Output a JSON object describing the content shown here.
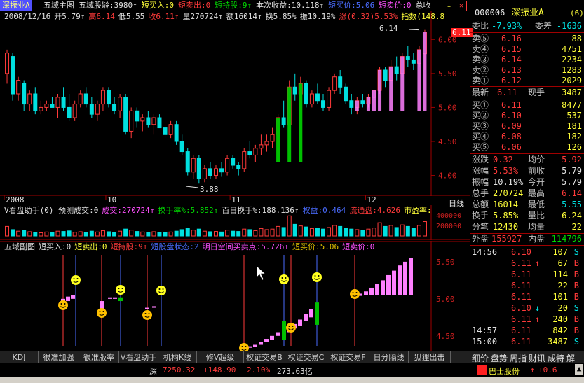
{
  "main_header": {
    "stock_name": "深振业A",
    "items": [
      {
        "text": "五域主图",
        "color": "#e0e0e0"
      },
      {
        "text": "五域股龄:3980↑",
        "color": "#e0e0e0"
      },
      {
        "text": "短买入:0",
        "color": "#ffff3a"
      },
      {
        "text": "短卖出:0",
        "color": "#ff3a3a"
      },
      {
        "text": "短持股:9↑",
        "color": "#00d800"
      },
      {
        "text": "本次收益:10.118↑",
        "color": "#e0e0e0"
      },
      {
        "text": "短买价:5.06",
        "color": "#4a6cff"
      },
      {
        "text": "短卖价:0",
        "color": "#ff50ff"
      },
      {
        "text": "总收",
        "color": "#e0e0e0"
      }
    ],
    "info2": [
      {
        "text": "2008/12/16",
        "color": "#e0e0e0"
      },
      {
        "text": "开5.79↑",
        "color": "#e0e0e0"
      },
      {
        "text": "高6.14",
        "color": "#ff3a3a"
      },
      {
        "text": "低5.55",
        "color": "#e0e0e0"
      },
      {
        "text": "收6.11↑",
        "color": "#ff3a3a"
      },
      {
        "text": "量270724↑",
        "color": "#e0e0e0"
      },
      {
        "text": "额16014↑",
        "color": "#e0e0e0"
      },
      {
        "text": "换5.85%",
        "color": "#e0e0e0"
      },
      {
        "text": "振10.19%",
        "color": "#e0e0e0"
      },
      {
        "text": "涨(0.32)5.53%",
        "color": "#ff3a3a"
      },
      {
        "text": "指数(148.8",
        "color": "#ffff3a"
      }
    ],
    "high_marker": "6.14",
    "low_marker": "3.88",
    "price_tag": "6.11",
    "y_labels": [
      "6.00",
      "5.50",
      "5.00",
      "4.50",
      "4.00"
    ],
    "x_labels": [
      "2008",
      "10",
      "11",
      "12"
    ],
    "daily_label": "日线"
  },
  "vol_header": {
    "items": [
      {
        "text": "V看盘助手(0) 预测成交:0",
        "color": "#e0e0e0"
      },
      {
        "text": "成交:270724↑",
        "color": "#ff50ff"
      },
      {
        "text": "换手率%:5.852↑",
        "color": "#00d800"
      },
      {
        "text": "百日换手%:188.136↑",
        "color": "#e0e0e0"
      },
      {
        "text": "权益:0.464",
        "color": "#4a6cff"
      },
      {
        "text": "流通盘:4.626",
        "color": "#ff3a3a"
      },
      {
        "text": "市盈率:",
        "color": "#ffff3a"
      }
    ],
    "y_labels": [
      "400000",
      "200000"
    ]
  },
  "sub_header": {
    "items": [
      {
        "text": "五域副图",
        "color": "#e0e0e0"
      },
      {
        "text": "短买入:0",
        "color": "#e0e0e0"
      },
      {
        "text": "短卖出:0",
        "color": "#ffff3a"
      },
      {
        "text": "短持股:9↑",
        "color": "#ff3a3a"
      },
      {
        "text": "短股盘状态:2",
        "color": "#4a6cff"
      },
      {
        "text": "明日空间买卖点:5.726↑",
        "color": "#ff50ff"
      },
      {
        "text": "短买价:5.06",
        "color": "#e0c000"
      },
      {
        "text": "短卖价:0",
        "color": "#ff50ff"
      }
    ],
    "y_labels": [
      "5.50",
      "5.00",
      "4.50"
    ]
  },
  "tabs": [
    "KDJ",
    "很准加强",
    "很准版率",
    "V看盘助手",
    "机构K线",
    "修V超级MACD",
    "权证交易B",
    "权证交易C",
    "权证交易F",
    "日分隔线",
    "狐狸出击"
  ],
  "right_panel": {
    "code": "000006",
    "name": "深振业A",
    "weibi_label": "委比",
    "weibi_value": "-7.93%",
    "weicha_label": "委差",
    "weicha_value": "-1636",
    "sells": [
      {
        "label": "卖⑤",
        "price": "6.16",
        "vol": "88"
      },
      {
        "label": "卖④",
        "price": "6.15",
        "vol": "4751"
      },
      {
        "label": "卖③",
        "price": "6.14",
        "vol": "2234"
      },
      {
        "label": "卖②",
        "price": "6.13",
        "vol": "1283"
      },
      {
        "label": "卖①",
        "price": "6.12",
        "vol": "2029"
      }
    ],
    "latest_label": "最新",
    "latest_price": "6.11",
    "xianshou_label": "现手",
    "xianshou_value": "3487",
    "buys": [
      {
        "label": "买①",
        "price": "6.11",
        "vol": "8477"
      },
      {
        "label": "买②",
        "price": "6.10",
        "vol": "537"
      },
      {
        "label": "买③",
        "price": "6.09",
        "vol": "181"
      },
      {
        "label": "买④",
        "price": "6.08",
        "vol": "182"
      },
      {
        "label": "买⑤",
        "price": "6.06",
        "vol": "126"
      }
    ],
    "stats": [
      {
        "l1": "涨跌",
        "v1": "0.32",
        "c1": "#ff3a3a",
        "l2": "均价",
        "v2": "5.92",
        "c2": "#ff3a3a"
      },
      {
        "l1": "涨幅",
        "v1": "5.53%",
        "c1": "#ff3a3a",
        "l2": "前收",
        "v2": "5.79",
        "c2": "#e0e0e0"
      },
      {
        "l1": "振幅",
        "v1": "10.19%",
        "c1": "#e0e0e0",
        "l2": "今开",
        "v2": "5.79",
        "c2": "#e0e0e0"
      },
      {
        "l1": "总手",
        "v1": "270724",
        "c1": "#ffff3a",
        "l2": "最高",
        "v2": "6.14",
        "c2": "#ff3a3a"
      },
      {
        "l1": "总额",
        "v1": "16014",
        "c1": "#ffff3a",
        "l2": "最低",
        "v2": "5.55",
        "c2": "#00e0e0"
      },
      {
        "l1": "换手",
        "v1": "5.85%",
        "c1": "#ffff3a",
        "l2": "量比",
        "v2": "6.24",
        "c2": "#ffff3a"
      },
      {
        "l1": "分笔",
        "v1": "12430",
        "c1": "#ffff3a",
        "l2": "均量",
        "v2": "22",
        "c2": "#ffff3a"
      }
    ],
    "waipan_label": "外盘",
    "waipan_value": "155927",
    "neipan_label": "内盘",
    "neipan_value": "114796",
    "ticks": [
      {
        "time": "14:56",
        "price": "6.10",
        "arrow": "",
        "vol": "107",
        "side": "S"
      },
      {
        "time": "",
        "price": "6.11",
        "arrow": "↑",
        "vol": "67",
        "side": "B"
      },
      {
        "time": "",
        "price": "6.11",
        "arrow": "",
        "vol": "114",
        "side": "B"
      },
      {
        "time": "",
        "price": "6.11",
        "arrow": "",
        "vol": "22",
        "side": "B"
      },
      {
        "time": "",
        "price": "6.11",
        "arrow": "",
        "vol": "101",
        "side": "B"
      },
      {
        "time": "",
        "price": "6.10",
        "arrow": "↓",
        "vol": "20",
        "side": "S"
      },
      {
        "time": "",
        "price": "6.11",
        "arrow": "↑",
        "vol": "240",
        "side": "B"
      },
      {
        "time": "14:57",
        "price": "6.11",
        "arrow": "",
        "vol": "842",
        "side": "B"
      },
      {
        "time": "15:00",
        "price": "6.11",
        "arrow": "",
        "vol": "3487",
        "side": "S"
      }
    ],
    "bottom_tabs": [
      "细价",
      "盘势",
      "周指",
      "财讯",
      "成特",
      "解"
    ]
  },
  "ticker": {
    "market": "深",
    "index": "7250.32",
    "change": "+148.90",
    "pct": "2.10%",
    "amount": "273.63亿",
    "broker": "巴士股份",
    "broker_arrow": "↑",
    "broker_change": "+0.6"
  },
  "colors": {
    "up": "#ff3a3a",
    "down": "#00e0e0",
    "pink": "#ff80ff",
    "green": "#00c000",
    "frame": "#a00000"
  },
  "chart_data": [
    {
      "type": "candlestick",
      "title": "五域主图",
      "ylim": [
        3.8,
        6.25
      ],
      "y_ticks": [
        4.0,
        4.5,
        5.0,
        5.5,
        6.0
      ],
      "x_labels": [
        "2008",
        "10",
        "11",
        "12"
      ],
      "ohlc": [
        [
          5.5,
          5.85,
          5.35,
          5.8
        ],
        [
          5.75,
          5.8,
          5.1,
          5.2
        ],
        [
          5.2,
          5.45,
          5.1,
          5.4
        ],
        [
          5.35,
          5.4,
          4.95,
          5.05
        ],
        [
          5.05,
          5.25,
          4.95,
          5.2
        ],
        [
          5.2,
          5.3,
          4.9,
          4.95
        ],
        [
          4.95,
          5.1,
          4.9,
          5.0
        ],
        [
          5.0,
          5.1,
          4.95,
          5.05
        ],
        [
          5.05,
          5.15,
          5.0,
          5.0
        ],
        [
          5.0,
          5.2,
          4.85,
          5.15
        ],
        [
          5.15,
          5.3,
          4.95,
          5.0
        ],
        [
          5.0,
          5.2,
          4.8,
          4.85
        ],
        [
          4.85,
          5.1,
          4.8,
          5.05
        ],
        [
          5.05,
          5.25,
          5.0,
          5.2
        ],
        [
          5.2,
          5.3,
          5.0,
          5.05
        ],
        [
          5.05,
          5.15,
          4.85,
          4.9
        ],
        [
          4.9,
          5.1,
          4.8,
          5.05
        ],
        [
          5.05,
          5.3,
          4.95,
          5.25
        ],
        [
          5.25,
          5.3,
          5.0,
          5.05
        ],
        [
          5.05,
          5.15,
          4.9,
          4.95
        ],
        [
          4.95,
          5.2,
          4.85,
          5.15
        ],
        [
          5.15,
          5.2,
          4.6,
          4.65
        ],
        [
          4.65,
          5.0,
          4.55,
          4.95
        ],
        [
          4.95,
          5.0,
          4.7,
          4.8
        ],
        [
          4.8,
          4.9,
          4.65,
          4.85
        ],
        [
          4.85,
          4.95,
          4.7,
          4.75
        ],
        [
          4.75,
          4.9,
          4.6,
          4.85
        ],
        [
          4.85,
          4.9,
          4.7,
          4.7
        ],
        [
          4.7,
          4.75,
          4.55,
          4.6
        ],
        [
          4.6,
          4.8,
          4.55,
          4.75
        ],
        [
          4.75,
          4.8,
          4.45,
          4.5
        ],
        [
          4.5,
          4.6,
          4.3,
          4.35
        ],
        [
          4.35,
          4.4,
          4.0,
          4.05
        ],
        [
          4.05,
          4.3,
          3.95,
          4.25
        ],
        [
          4.25,
          4.3,
          3.88,
          3.95
        ],
        [
          3.95,
          4.15,
          3.9,
          4.1
        ],
        [
          4.1,
          4.2,
          3.95,
          4.0
        ],
        [
          4.0,
          4.15,
          3.95,
          4.1
        ],
        [
          4.1,
          4.2,
          3.98,
          4.05
        ],
        [
          4.05,
          4.3,
          4.0,
          4.25
        ],
        [
          4.25,
          4.3,
          4.1,
          4.15
        ],
        [
          4.15,
          4.2,
          4.0,
          4.1
        ],
        [
          4.1,
          4.4,
          4.05,
          4.35
        ],
        [
          4.35,
          4.5,
          4.25,
          4.3
        ],
        [
          4.3,
          4.45,
          4.2,
          4.4
        ],
        [
          4.4,
          4.6,
          4.3,
          4.45
        ],
        [
          4.45,
          4.6,
          4.35,
          4.5
        ],
        [
          4.5,
          4.7,
          4.4,
          4.6
        ],
        [
          4.6,
          4.9,
          4.5,
          4.85
        ],
        [
          4.85,
          5.1,
          4.7,
          4.75
        ],
        [
          4.75,
          5.4,
          4.7,
          5.3
        ],
        [
          5.3,
          5.5,
          5.1,
          5.2
        ],
        [
          5.2,
          5.45,
          5.05,
          5.35
        ],
        [
          5.35,
          5.4,
          5.0,
          5.05
        ],
        [
          5.05,
          5.25,
          5.0,
          5.2
        ],
        [
          5.2,
          5.35,
          5.05,
          5.1
        ],
        [
          5.1,
          5.2,
          4.95,
          5.0
        ],
        [
          5.0,
          5.3,
          4.95,
          5.25
        ],
        [
          5.25,
          5.5,
          5.2,
          5.45
        ],
        [
          5.45,
          5.55,
          5.2,
          5.3
        ],
        [
          5.3,
          5.35,
          5.05,
          5.1
        ],
        [
          5.1,
          5.2,
          4.9,
          5.0
        ],
        [
          5.0,
          5.15,
          4.9,
          5.1
        ],
        [
          5.1,
          5.2,
          5.0,
          5.05
        ],
        [
          5.05,
          5.2,
          5.0,
          5.15
        ],
        [
          5.15,
          5.3,
          5.1,
          5.25
        ],
        [
          5.25,
          5.6,
          5.2,
          5.55
        ],
        [
          5.55,
          5.6,
          5.3,
          5.4
        ],
        [
          5.4,
          5.7,
          5.35,
          5.6
        ],
        [
          5.6,
          5.75,
          5.4,
          5.5
        ],
        [
          5.5,
          5.8,
          5.45,
          5.75
        ],
        [
          5.75,
          5.9,
          5.6,
          5.7
        ],
        [
          5.7,
          5.8,
          5.55,
          5.65
        ],
        [
          5.65,
          5.9,
          5.6,
          5.85
        ],
        [
          5.79,
          6.14,
          5.55,
          6.11
        ]
      ]
    },
    {
      "type": "bar",
      "title": "V看盘助手",
      "ylim": [
        0,
        450000
      ],
      "y_ticks": [
        200000,
        400000
      ],
      "values": [
        180000,
        120000,
        90000,
        110000,
        80000,
        70000,
        60000,
        75000,
        65000,
        90000,
        85000,
        95000,
        70000,
        80000,
        60000,
        90000,
        75000,
        100000,
        80000,
        70000,
        90000,
        130000,
        110000,
        85000,
        75000,
        70000,
        80000,
        60000,
        70000,
        75000,
        90000,
        120000,
        150000,
        110000,
        130000,
        90000,
        80000,
        85000,
        75000,
        110000,
        90000,
        85000,
        130000,
        120000,
        100000,
        140000,
        120000,
        130000,
        180000,
        160000,
        380000,
        220000,
        190000,
        170000,
        140000,
        150000,
        130000,
        160000,
        200000,
        180000,
        150000,
        130000,
        120000,
        110000,
        130000,
        150000,
        250000,
        180000,
        200000,
        160000,
        210000,
        180000,
        150000,
        200000,
        270724
      ]
    },
    {
      "type": "bar",
      "title": "五域副图",
      "ylim": [
        4.3,
        5.65
      ],
      "y_ticks": [
        4.5,
        5.0,
        5.5
      ]
    }
  ]
}
